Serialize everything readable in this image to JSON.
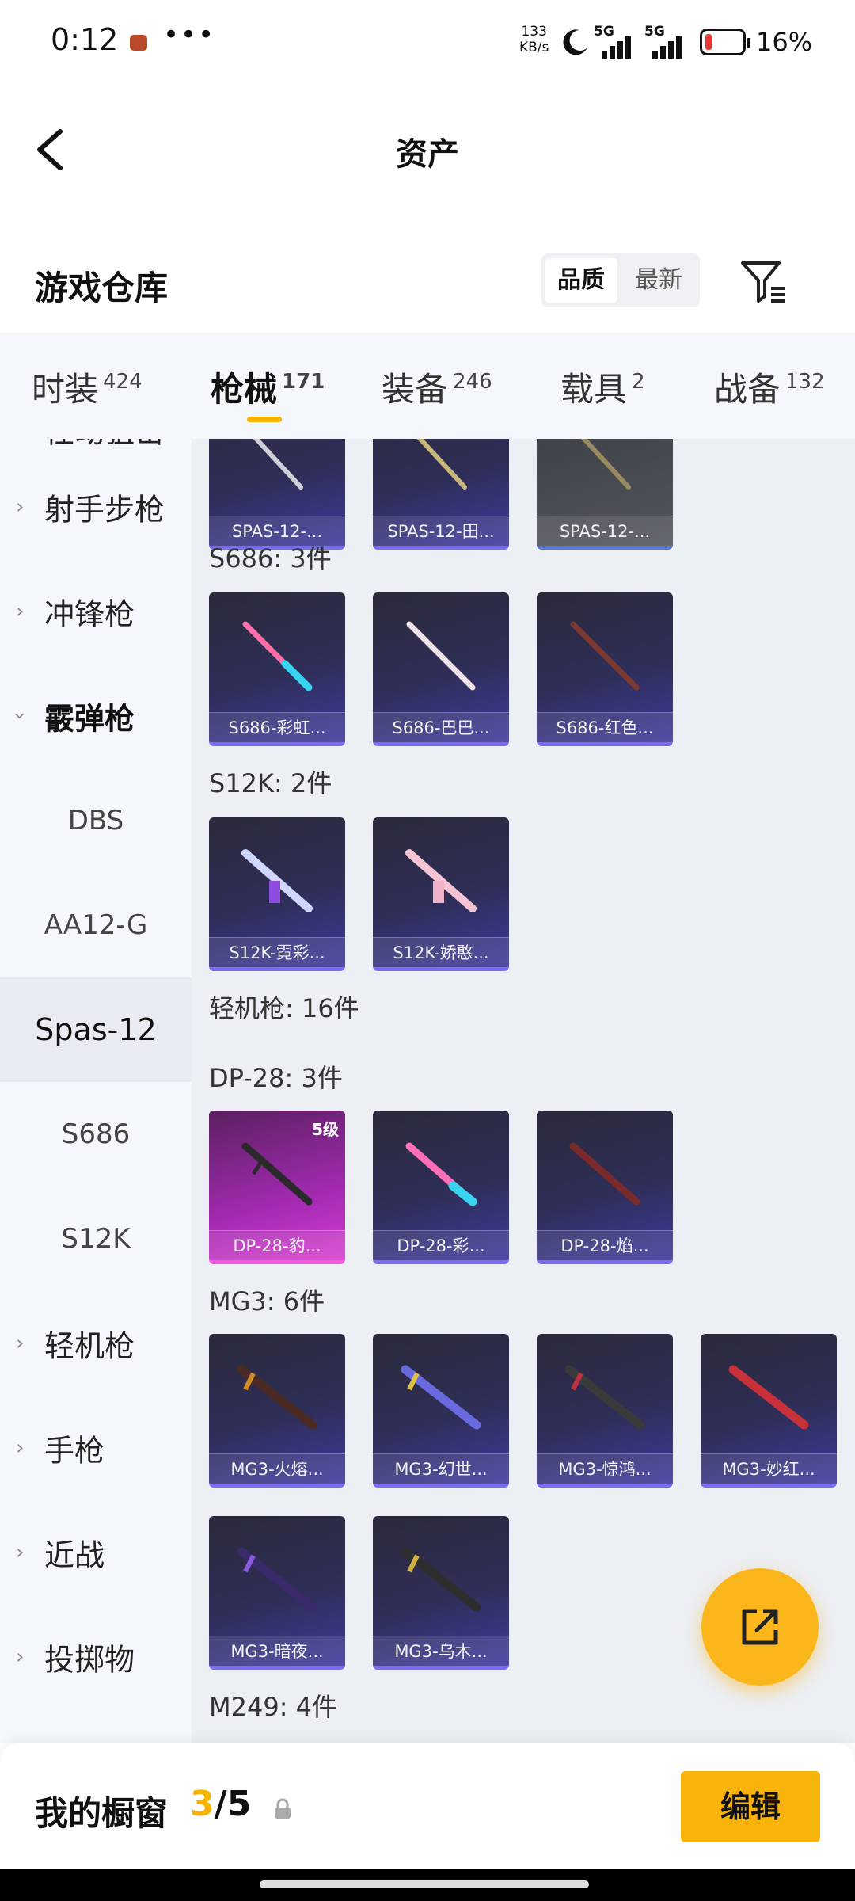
{
  "status_bar": {
    "time": "0:12",
    "speed_value": "133",
    "speed_unit": "KB/s",
    "sim1_label": "5G",
    "sim2_label": "5G",
    "battery_percent": "16%",
    "battery_level": 0.16
  },
  "header": {
    "title": "资产"
  },
  "warehouse": {
    "title": "游戏仓库",
    "sort_options": [
      "品质",
      "最新"
    ],
    "sort_selected": "品质"
  },
  "tabs": [
    {
      "label": "时装",
      "count": "424"
    },
    {
      "label": "枪械",
      "count": "171",
      "active": true
    },
    {
      "label": "装备",
      "count": "246"
    },
    {
      "label": "载具",
      "count": "2"
    },
    {
      "label": "战备",
      "count": "132"
    }
  ],
  "categories": {
    "partial_top": "栓动狙击",
    "items": [
      "射手步枪",
      "冲锋枪",
      "霰弹枪"
    ],
    "subitems": [
      "DBS",
      "AA12-G",
      "Spas-12",
      "S686",
      "S12K"
    ],
    "selected": "Spas-12",
    "after": [
      "轻机枪",
      "手枪",
      "近战",
      "投掷物"
    ]
  },
  "content": {
    "spas_row": [
      "SPAS-12-...",
      "SPAS-12-田...",
      "SPAS-12-..."
    ],
    "s686_title": "S686: 3件",
    "s686": [
      "S686-彩虹...",
      "S686-巴巴...",
      "S686-红色..."
    ],
    "s12k_title": "S12K: 2件",
    "s12k": [
      "S12K-霓彩...",
      "S12K-娇憨..."
    ],
    "lmg_title": "轻机枪: 16件",
    "dp28_title": "DP-28: 3件",
    "dp28": [
      "DP-28-豹...",
      "DP-28-彩...",
      "DP-28-焰..."
    ],
    "dp28_level": "5级",
    "mg3_title": "MG3: 6件",
    "mg3": [
      "MG3-火熔...",
      "MG3-幻世...",
      "MG3-惊鸿...",
      "MG3-妙红...",
      "MG3-暗夜...",
      "MG3-乌木..."
    ],
    "m249_title": "M249: 4件"
  },
  "bottom": {
    "showcase_label": "我的橱窗",
    "showcase_current": "3",
    "showcase_sep": "/",
    "showcase_total": "5",
    "edit_label": "编辑"
  },
  "colors": {
    "accent": "#f9b30a",
    "tab_underline": "#f5b300"
  }
}
